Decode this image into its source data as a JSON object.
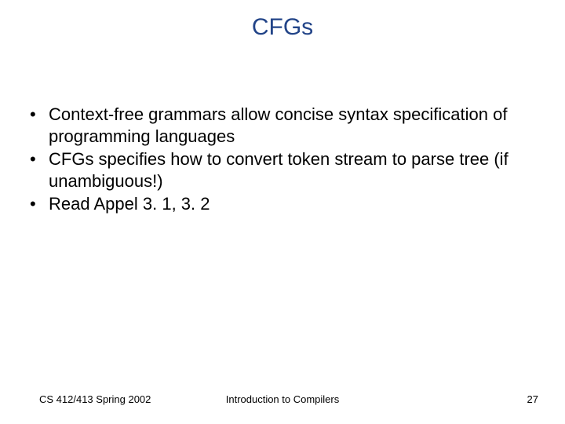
{
  "slide": {
    "title": "CFGs",
    "bullets": [
      "Context-free grammars allow concise syntax specification of programming languages",
      "CFGs specifies how to convert token stream to parse tree (if unambiguous!)",
      "Read Appel 3. 1, 3. 2"
    ],
    "footer": {
      "left": "CS 412/413   Spring 2002",
      "center": "Introduction to Compilers",
      "right": "27"
    }
  }
}
